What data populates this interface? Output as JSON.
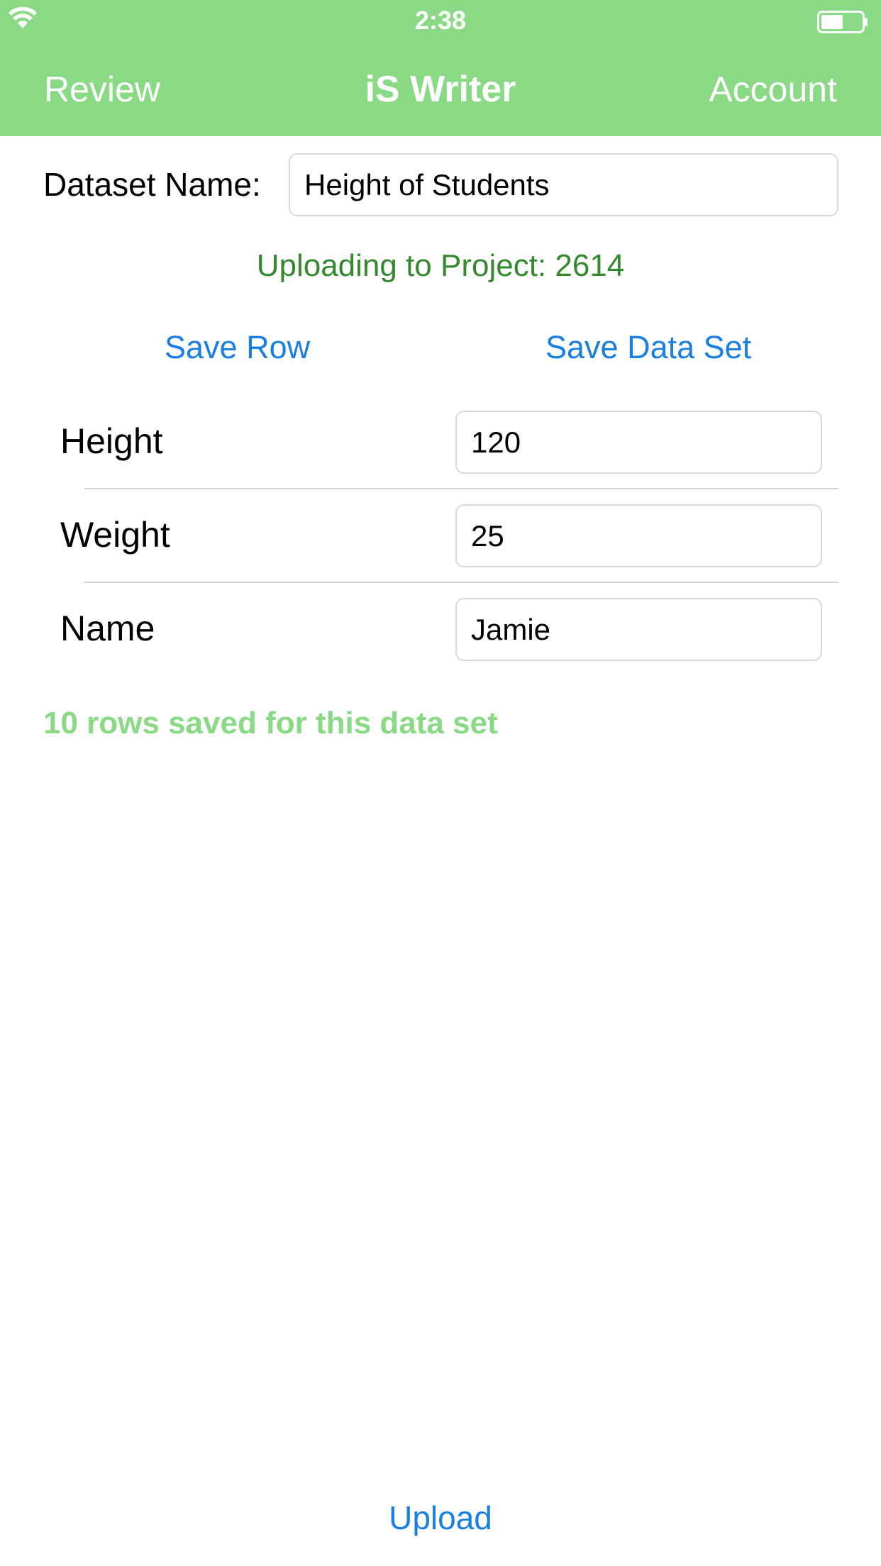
{
  "status_bar": {
    "time": "2:38",
    "wifi_icon": "wifi-icon",
    "battery_icon": "battery-icon"
  },
  "nav": {
    "left": "Review",
    "title": "iS Writer",
    "right": "Account"
  },
  "dataset": {
    "label": "Dataset Name:",
    "value": "Height of Students"
  },
  "project_line": "Uploading to Project: 2614",
  "actions": {
    "save_row": "Save Row",
    "save_data_set": "Save Data Set",
    "upload": "Upload"
  },
  "fields": [
    {
      "label": "Height",
      "value": "120"
    },
    {
      "label": "Weight",
      "value": "25"
    },
    {
      "label": "Name",
      "value": "Jamie"
    }
  ],
  "rows_saved": "10 rows saved for this data set",
  "colors": {
    "header_green": "#8ad985",
    "project_green": "#34892f",
    "link_blue": "#1a7fe3"
  }
}
